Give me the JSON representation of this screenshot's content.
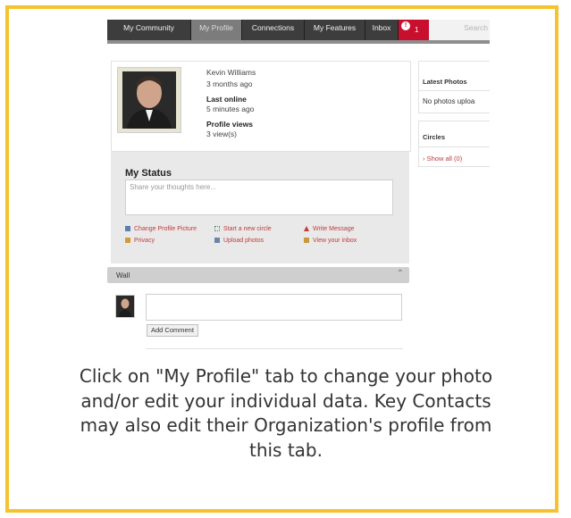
{
  "nav": {
    "tabs": [
      "My Community",
      "My Profile",
      "Connections",
      "My Features",
      "Inbox"
    ],
    "active_tab": "My Profile",
    "inbox_count": "1",
    "search_placeholder": "Search"
  },
  "profile": {
    "name": "Kevin Williams",
    "joined": "3 months ago",
    "last_online_label": "Last online",
    "last_online_value": "5 minutes ago",
    "views_label": "Profile views",
    "views_value": "3 view(s)"
  },
  "status": {
    "title": "My Status",
    "placeholder": "Share your thoughts here...",
    "actions": [
      "Change Profile Picture",
      "Start a new circle",
      "Write Message",
      "Privacy",
      "Upload photos",
      "View your inbox"
    ]
  },
  "wall": {
    "title": "Wall",
    "button": "Add Comment"
  },
  "sidebar": {
    "latest_photos_title": "Latest Photos",
    "no_photos": "No photos uploa",
    "circles_title": "Circles",
    "show_all": "Show all (0)"
  },
  "caption": "Click on \"My Profile\" tab to change your photo and/or edit your individual data. Key Contacts may also edit their Organization's profile from this tab.",
  "colors": {
    "frame": "#f6c22f",
    "link": "#c23b3b",
    "inbox": "#c8102e"
  }
}
